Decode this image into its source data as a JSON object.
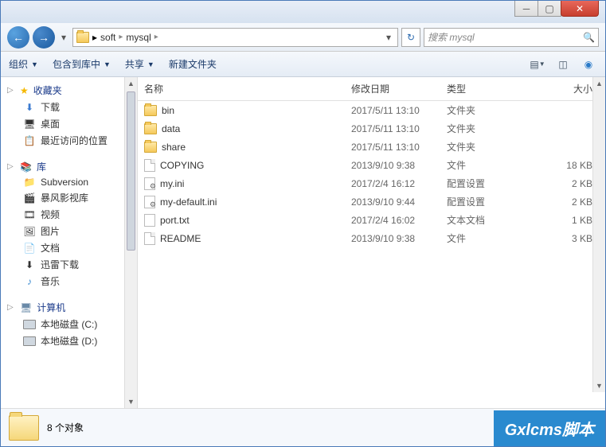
{
  "breadcrumb": {
    "items": [
      "soft",
      "mysql"
    ]
  },
  "search": {
    "placeholder": "搜索 mysql"
  },
  "toolbar": {
    "organize": "组织",
    "include": "包含到库中",
    "share": "共享",
    "newfolder": "新建文件夹"
  },
  "columns": {
    "name": "名称",
    "date": "修改日期",
    "type": "类型",
    "size": "大小"
  },
  "sidebar": {
    "favorites": {
      "label": "收藏夹",
      "items": [
        "下载",
        "桌面",
        "最近访问的位置"
      ]
    },
    "libraries": {
      "label": "库",
      "items": [
        "Subversion",
        "暴风影视库",
        "视频",
        "图片",
        "文档",
        "迅雷下载",
        "音乐"
      ]
    },
    "computer": {
      "label": "计算机",
      "items": [
        "本地磁盘 (C:)",
        "本地磁盘 (D:)"
      ]
    }
  },
  "files": [
    {
      "name": "bin",
      "date": "2017/5/11 13:10",
      "type": "文件夹",
      "size": "",
      "icon": "folder"
    },
    {
      "name": "data",
      "date": "2017/5/11 13:10",
      "type": "文件夹",
      "size": "",
      "icon": "folder"
    },
    {
      "name": "share",
      "date": "2017/5/11 13:10",
      "type": "文件夹",
      "size": "",
      "icon": "folder"
    },
    {
      "name": "COPYING",
      "date": "2013/9/10 9:38",
      "type": "文件",
      "size": "18 KB",
      "icon": "file"
    },
    {
      "name": "my.ini",
      "date": "2017/2/4 16:12",
      "type": "配置设置",
      "size": "2 KB",
      "icon": "ini"
    },
    {
      "name": "my-default.ini",
      "date": "2013/9/10 9:44",
      "type": "配置设置",
      "size": "2 KB",
      "icon": "ini"
    },
    {
      "name": "port.txt",
      "date": "2017/2/4 16:02",
      "type": "文本文档",
      "size": "1 KB",
      "icon": "txt"
    },
    {
      "name": "README",
      "date": "2013/9/10 9:38",
      "type": "文件",
      "size": "3 KB",
      "icon": "file"
    }
  ],
  "status": {
    "count": "8 个对象"
  },
  "watermark": "Gxlcms脚本"
}
